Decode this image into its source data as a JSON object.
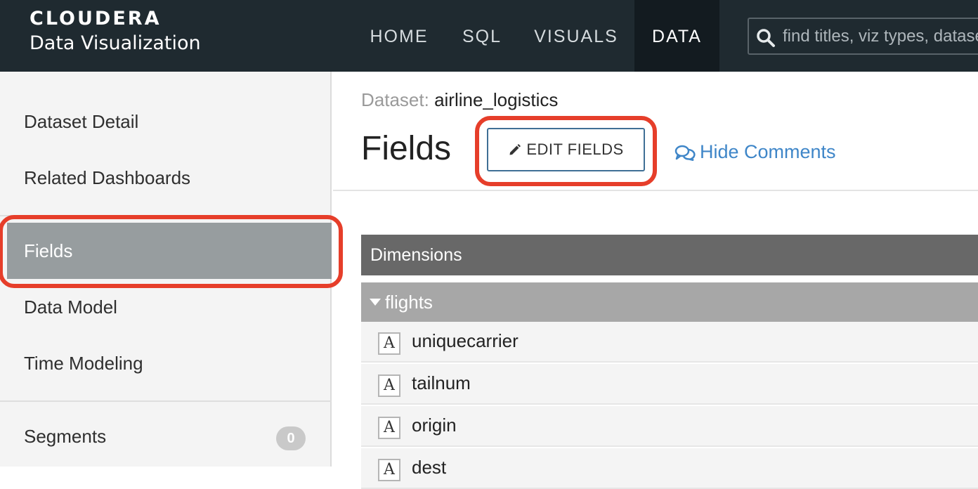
{
  "brand": {
    "logo": "CLOUDERA",
    "product": "Data Visualization"
  },
  "nav": {
    "items": [
      {
        "label": "HOME"
      },
      {
        "label": "SQL"
      },
      {
        "label": "VISUALS"
      },
      {
        "label": "DATA",
        "active": true
      }
    ],
    "search_placeholder": "find titles, viz types, datasets"
  },
  "sidebar": {
    "items": [
      {
        "label": "Dataset Detail"
      },
      {
        "label": "Related Dashboards"
      },
      {
        "label": "Fields",
        "active": true
      },
      {
        "label": "Data Model"
      },
      {
        "label": "Time Modeling"
      },
      {
        "label": "Segments",
        "badge": "0"
      }
    ]
  },
  "main": {
    "dataset_label": "Dataset:",
    "dataset_name": "airline_logistics",
    "title": "Fields",
    "edit_fields_label": "EDIT FIELDS",
    "hide_comments_label": "Hide Comments",
    "dimensions_header": "Dimensions",
    "group_name": "flights",
    "fields": [
      {
        "type_icon": "A",
        "name": "uniquecarrier"
      },
      {
        "type_icon": "A",
        "name": "tailnum"
      },
      {
        "type_icon": "A",
        "name": "origin"
      },
      {
        "type_icon": "A",
        "name": "dest"
      }
    ]
  },
  "colors": {
    "topbar": "#1f2a30",
    "nav_active_underline": "#4a90c8",
    "highlight_ring": "#e63e2a",
    "link": "#3f86c8",
    "sidebar_active": "#979d9f",
    "dimensions_header": "#686868",
    "group_header": "#a7a7a7"
  }
}
